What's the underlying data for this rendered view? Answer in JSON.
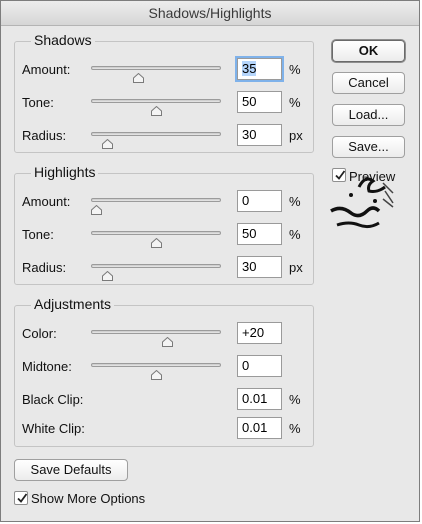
{
  "window": {
    "title": "Shadows/Highlights"
  },
  "shadows": {
    "title": "Shadows",
    "amount": {
      "label": "Amount:",
      "value": "35",
      "unit": "%",
      "level": 0.35
    },
    "tone": {
      "label": "Tone:",
      "value": "50",
      "unit": "%",
      "level": 0.5
    },
    "radius": {
      "label": "Radius:",
      "value": "30",
      "unit": "px",
      "level": 0.09
    }
  },
  "highlights": {
    "title": "Highlights",
    "amount": {
      "label": "Amount:",
      "value": "0",
      "unit": "%",
      "level": 0.0
    },
    "tone": {
      "label": "Tone:",
      "value": "50",
      "unit": "%",
      "level": 0.5
    },
    "radius": {
      "label": "Radius:",
      "value": "30",
      "unit": "px",
      "level": 0.09
    }
  },
  "adjustments": {
    "title": "Adjustments",
    "color": {
      "label": "Color:",
      "value": "+20",
      "level": 0.6
    },
    "midtone": {
      "label": "Midtone:",
      "value": "0",
      "level": 0.5
    },
    "black_clip": {
      "label": "Black Clip:",
      "value": "0.01",
      "unit": "%"
    },
    "white_clip": {
      "label": "White Clip:",
      "value": "0.01",
      "unit": "%"
    }
  },
  "buttons": {
    "ok": "OK",
    "cancel": "Cancel",
    "load": "Load...",
    "save": "Save...",
    "save_defaults": "Save Defaults"
  },
  "preview": {
    "label": "Preview",
    "checked": true
  },
  "show_more": {
    "label": "Show More Options",
    "checked": true
  },
  "colors": {
    "focus_ring": "#7fb2ea",
    "selection": "#b5d5fb",
    "dialog_bg": "#e8e8e8"
  },
  "icons": [
    "checkmark-icon",
    "slider-thumb-icon",
    "watermark-logo"
  ]
}
